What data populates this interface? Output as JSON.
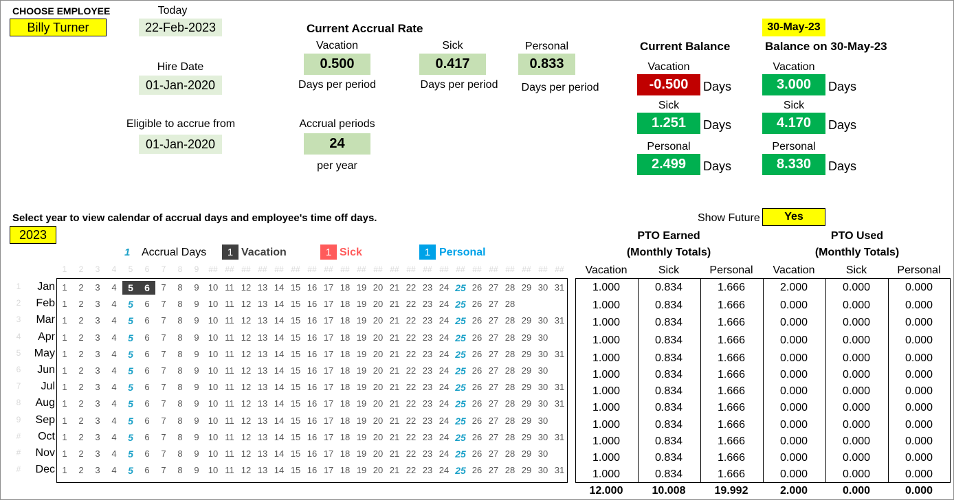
{
  "employee": {
    "label": "CHOOSE EMPLOYEE",
    "name": "Billy Turner"
  },
  "today": {
    "label": "Today",
    "value": "22-Feb-2023"
  },
  "hire": {
    "label": "Hire Date",
    "value": "01-Jan-2020"
  },
  "eligible": {
    "label": "Eligible to accrue from",
    "value": "01-Jan-2020"
  },
  "accrual_rate": {
    "title": "Current Accrual Rate",
    "vacation": {
      "label": "Vacation",
      "value": "0.500",
      "unit": "Days per period"
    },
    "sick": {
      "label": "Sick",
      "value": "0.417",
      "unit": "Days per period"
    },
    "personal": {
      "label": "Personal",
      "value": "0.833",
      "unit": "Days per period"
    },
    "periods": {
      "label": "Accrual periods",
      "value": "24",
      "unit": "per year"
    }
  },
  "current_balance": {
    "title": "Current Balance",
    "vacation": {
      "label": "Vacation",
      "value": "-0.500",
      "unit": "Days"
    },
    "sick": {
      "label": "Sick",
      "value": "1.251",
      "unit": "Days"
    },
    "personal": {
      "label": "Personal",
      "value": "2.499",
      "unit": "Days"
    }
  },
  "future_balance": {
    "date": "30-May-23",
    "title": "Balance on 30-May-23",
    "vacation": {
      "label": "Vacation",
      "value": "3.000",
      "unit": "Days"
    },
    "sick": {
      "label": "Sick",
      "value": "4.170",
      "unit": "Days"
    },
    "personal": {
      "label": "Personal",
      "value": "8.330",
      "unit": "Days"
    }
  },
  "calendar": {
    "instruction": "Select year to view calendar of accrual days and employee's time off days.",
    "year": "2023",
    "show_future_label": "Show Future",
    "show_future_value": "Yes",
    "legend": {
      "accrual_num": "1",
      "accrual_label": "Accrual Days",
      "vacation_num": "1",
      "vacation_label": "Vacation",
      "sick_num": "1",
      "sick_label": "Sick",
      "personal_num": "1",
      "personal_label": "Personal"
    },
    "header_nums": [
      "1",
      "2",
      "3",
      "4",
      "5",
      "6",
      "7",
      "8",
      "9",
      "##",
      "##",
      "##",
      "##",
      "##",
      "##",
      "##",
      "##",
      "##",
      "##",
      "##",
      "##",
      "##",
      "##",
      "##",
      "##",
      "##",
      "##",
      "##",
      "##",
      "##",
      "##"
    ],
    "row_idx": [
      "1",
      "2",
      "3",
      "4",
      "5",
      "6",
      "7",
      "8",
      "9",
      "#",
      "#",
      "#"
    ],
    "accrual_days": [
      5,
      25
    ],
    "months": [
      {
        "name": "Jan",
        "days": 31,
        "vacation": [
          5,
          6
        ]
      },
      {
        "name": "Feb",
        "days": 28,
        "vacation": []
      },
      {
        "name": "Mar",
        "days": 31,
        "vacation": []
      },
      {
        "name": "Apr",
        "days": 30,
        "vacation": []
      },
      {
        "name": "May",
        "days": 31,
        "vacation": []
      },
      {
        "name": "Jun",
        "days": 30,
        "vacation": []
      },
      {
        "name": "Jul",
        "days": 31,
        "vacation": []
      },
      {
        "name": "Aug",
        "days": 31,
        "vacation": []
      },
      {
        "name": "Sep",
        "days": 30,
        "vacation": []
      },
      {
        "name": "Oct",
        "days": 31,
        "vacation": []
      },
      {
        "name": "Nov",
        "days": 30,
        "vacation": []
      },
      {
        "name": "Dec",
        "days": 31,
        "vacation": []
      }
    ]
  },
  "pto": {
    "earned_title_1": "PTO Earned",
    "earned_title_2": "(Monthly Totals)",
    "used_title_1": "PTO Used",
    "used_title_2": "(Monthly Totals)",
    "columns": [
      "Vacation",
      "Sick",
      "Personal",
      "Vacation",
      "Sick",
      "Personal"
    ],
    "rows": [
      [
        "1.000",
        "0.834",
        "1.666",
        "2.000",
        "0.000",
        "0.000"
      ],
      [
        "1.000",
        "0.834",
        "1.666",
        "0.000",
        "0.000",
        "0.000"
      ],
      [
        "1.000",
        "0.834",
        "1.666",
        "0.000",
        "0.000",
        "0.000"
      ],
      [
        "1.000",
        "0.834",
        "1.666",
        "0.000",
        "0.000",
        "0.000"
      ],
      [
        "1.000",
        "0.834",
        "1.666",
        "0.000",
        "0.000",
        "0.000"
      ],
      [
        "1.000",
        "0.834",
        "1.666",
        "0.000",
        "0.000",
        "0.000"
      ],
      [
        "1.000",
        "0.834",
        "1.666",
        "0.000",
        "0.000",
        "0.000"
      ],
      [
        "1.000",
        "0.834",
        "1.666",
        "0.000",
        "0.000",
        "0.000"
      ],
      [
        "1.000",
        "0.834",
        "1.666",
        "0.000",
        "0.000",
        "0.000"
      ],
      [
        "1.000",
        "0.834",
        "1.666",
        "0.000",
        "0.000",
        "0.000"
      ],
      [
        "1.000",
        "0.834",
        "1.666",
        "0.000",
        "0.000",
        "0.000"
      ],
      [
        "1.000",
        "0.834",
        "1.666",
        "0.000",
        "0.000",
        "0.000"
      ]
    ],
    "totals": [
      "12.000",
      "10.008",
      "19.992",
      "2.000",
      "0.000",
      "0.000"
    ]
  },
  "colors": {
    "input_yellow": "#ffff00",
    "rate_green": "#c6e0b4",
    "date_green": "#e2efda",
    "balance_negative": "#c00000",
    "balance_positive": "#00b050",
    "vacation_dark": "#404040",
    "sick_red": "#ff5b5b",
    "personal_blue": "#00a2e8",
    "accrual_blue": "#1ba1c8"
  }
}
